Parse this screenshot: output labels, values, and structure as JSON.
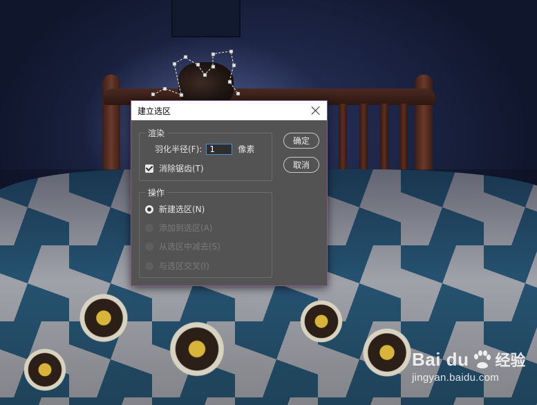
{
  "dialog": {
    "title": "建立选区",
    "render_group": {
      "title": "渲染",
      "feather_label": "羽化半径(F):",
      "feather_value": "1",
      "feather_unit": "像素",
      "antialias_label": "消除锯齿(T)",
      "antialias_checked": true
    },
    "operation_group": {
      "title": "操作",
      "options": [
        {
          "label": "新建选区(N)",
          "selected": true,
          "enabled": true
        },
        {
          "label": "添加到选区(A)",
          "selected": false,
          "enabled": false
        },
        {
          "label": "从选区中减去(S)",
          "selected": false,
          "enabled": false
        },
        {
          "label": "与选区交叉(I)",
          "selected": false,
          "enabled": false
        }
      ]
    },
    "ok_label": "确定",
    "cancel_label": "取消"
  },
  "watermark": {
    "brand": "Bai du",
    "brand_suffix": "经验",
    "url": "jingyan.baidu.com"
  },
  "colors": {
    "dialog_bg": "#535353",
    "accent_border": "#4a90d9",
    "dialog_border": "#8a5a8a"
  }
}
